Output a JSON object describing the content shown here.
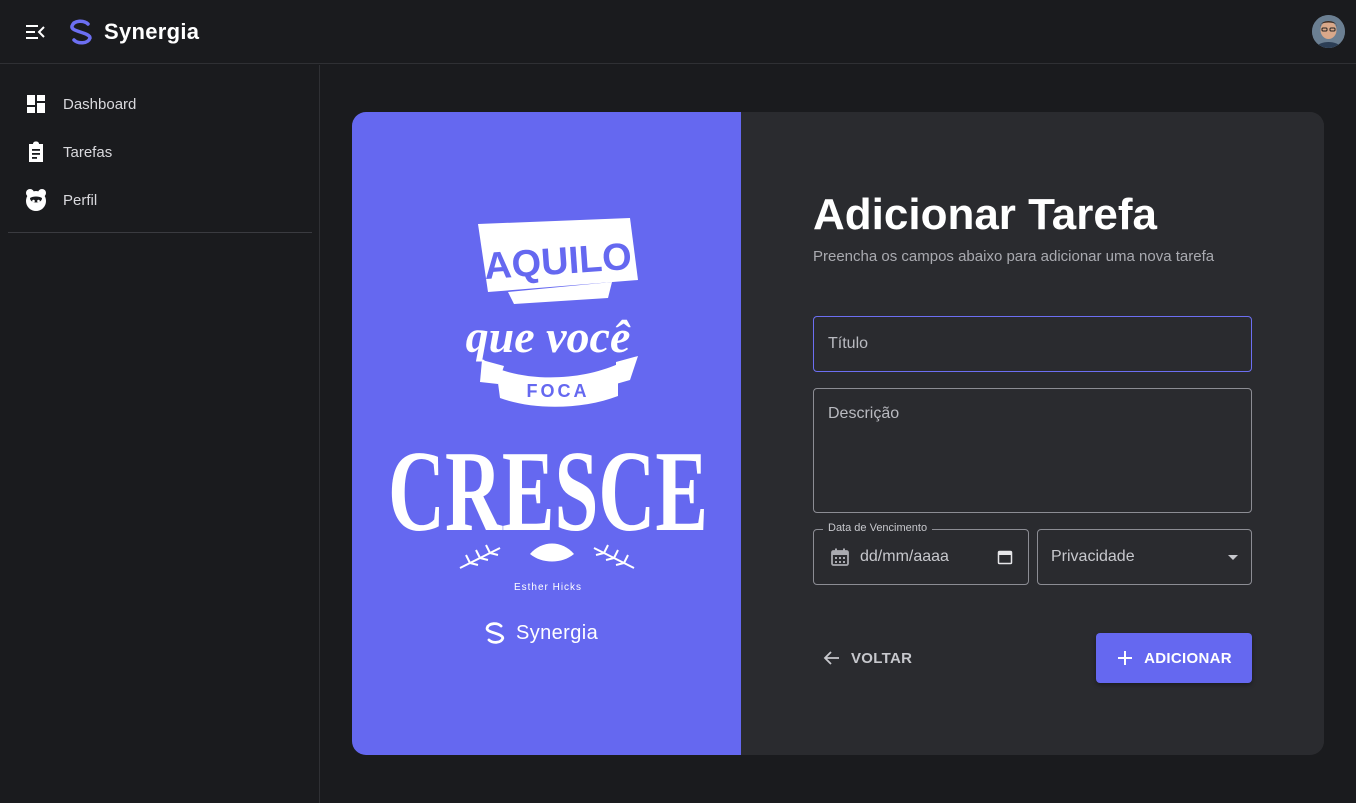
{
  "app": {
    "name": "Synergia"
  },
  "sidebar": {
    "items": [
      {
        "label": "Dashboard",
        "icon": "dashboard-icon"
      },
      {
        "label": "Tarefas",
        "icon": "clipboard-icon"
      },
      {
        "label": "Perfil",
        "icon": "face-icon"
      }
    ]
  },
  "poster": {
    "quote_lines": [
      "AQUILO",
      "que você",
      "FOCA",
      "CRESCE"
    ],
    "author": "Esther Hicks",
    "brand": "Synergia"
  },
  "form": {
    "title": "Adicionar Tarefa",
    "subtitle": "Preencha os campos abaixo para adicionar uma nova tarefa",
    "title_placeholder": "Título",
    "description_placeholder": "Descrição",
    "due_date_label": "Data de Vencimento",
    "due_date_value": "dd/mm/aaaa",
    "privacy_label": "Privacidade",
    "back_label": "VOLTAR",
    "add_label": "ADICIONAR"
  },
  "colors": {
    "accent": "#6568f0",
    "background": "#1a1b1e",
    "card": "#2a2b2f"
  }
}
